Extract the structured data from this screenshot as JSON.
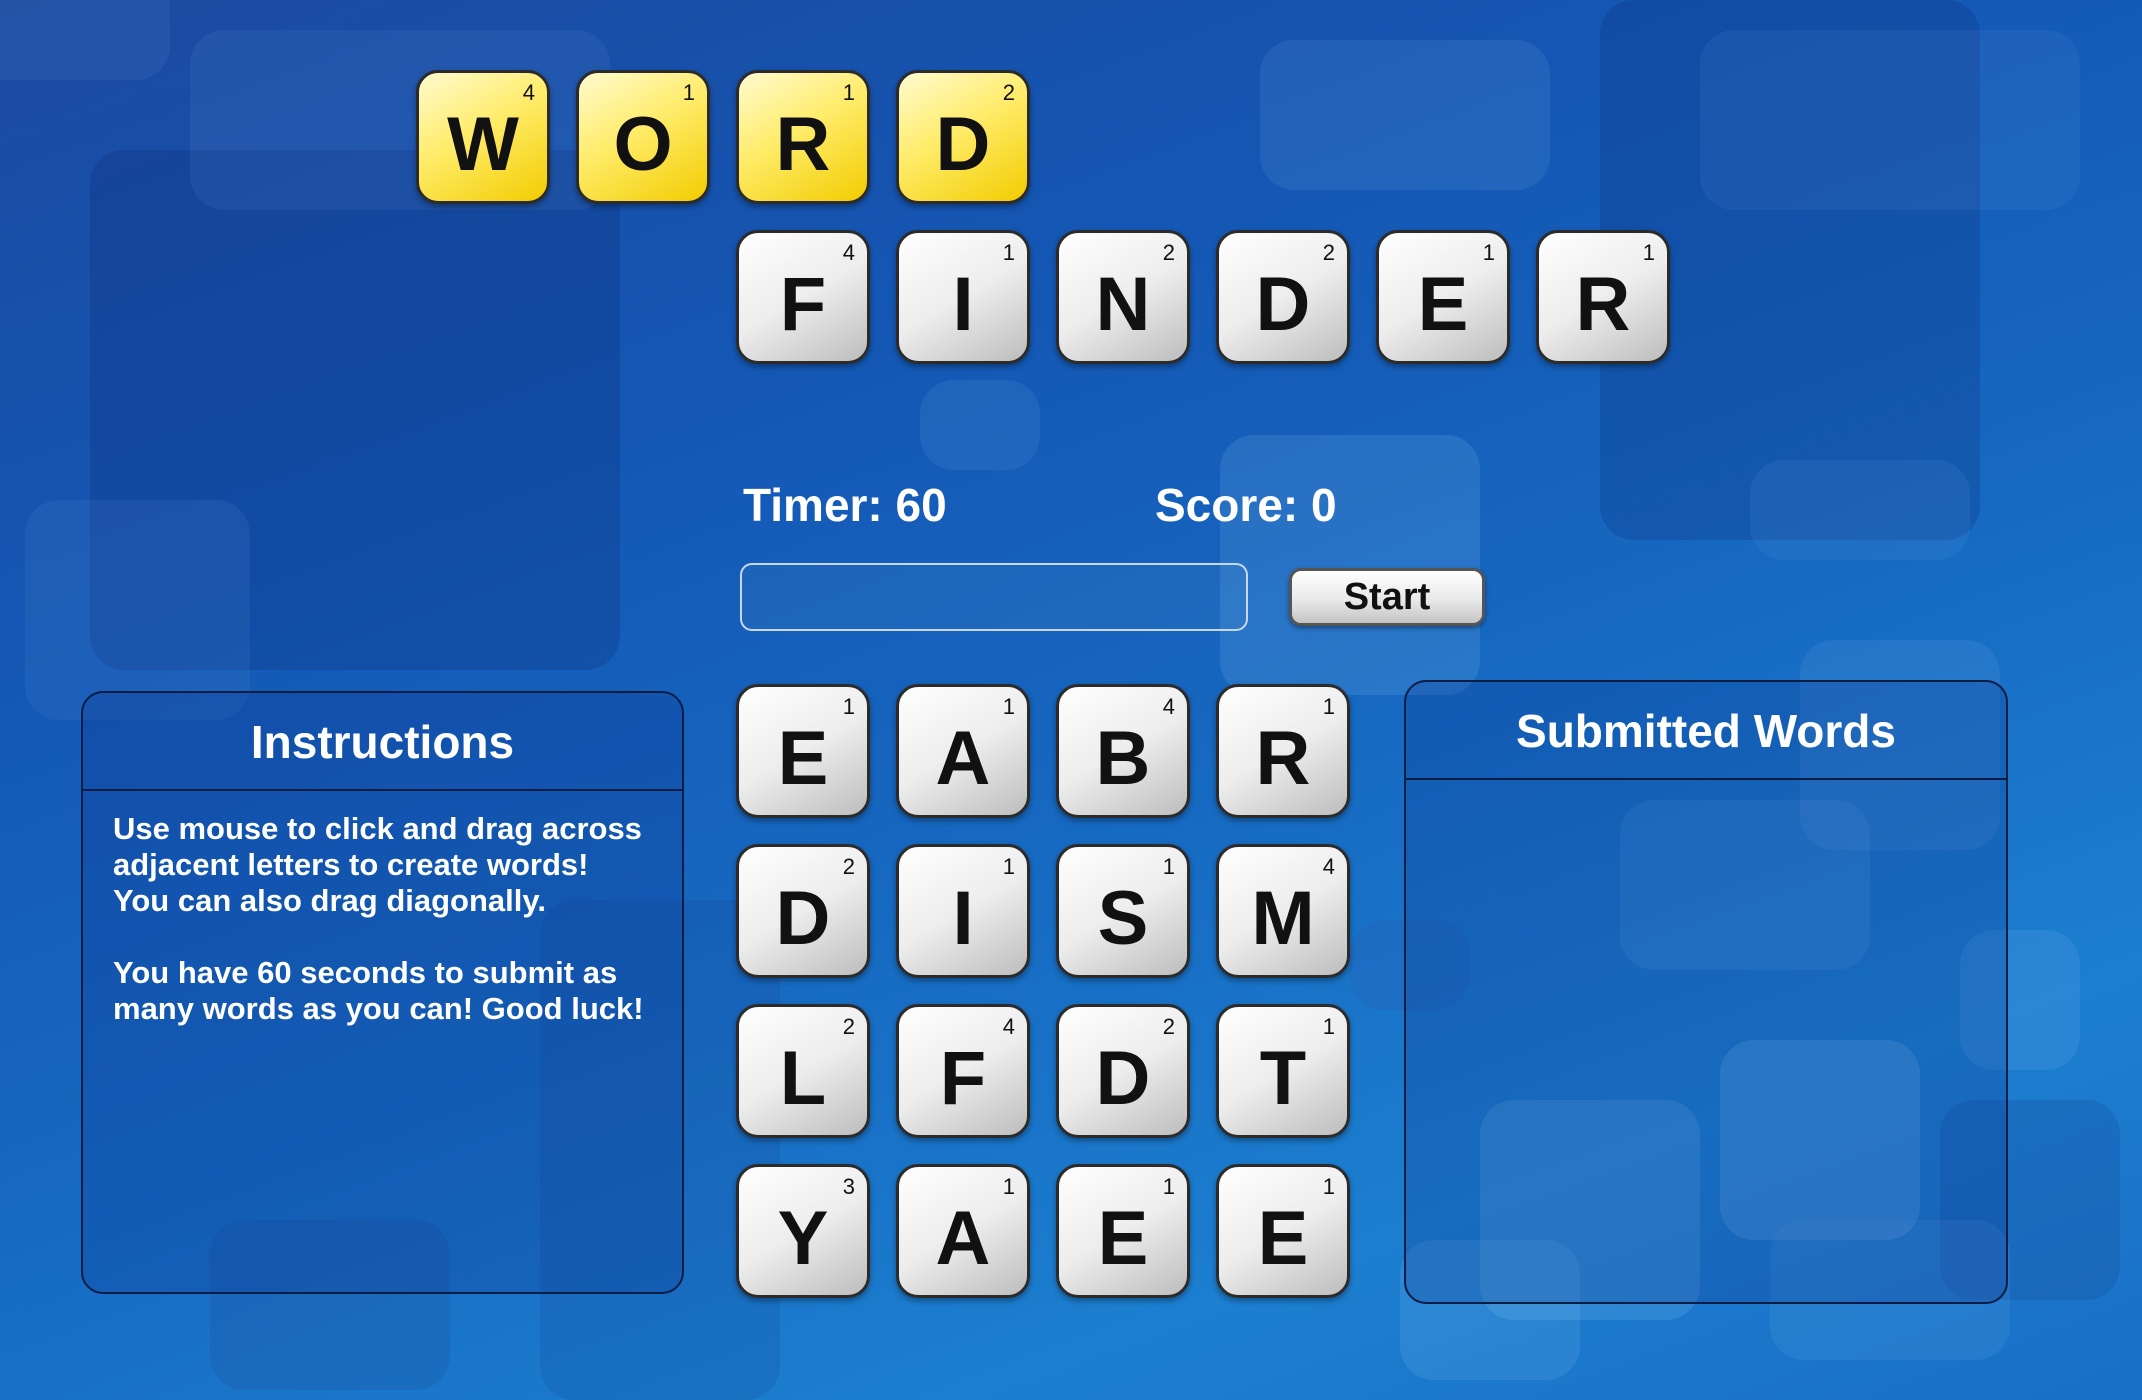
{
  "title": {
    "row1": [
      {
        "letter": "W",
        "points": "4"
      },
      {
        "letter": "O",
        "points": "1"
      },
      {
        "letter": "R",
        "points": "1"
      },
      {
        "letter": "D",
        "points": "2"
      }
    ],
    "row2": [
      {
        "letter": "F",
        "points": "4"
      },
      {
        "letter": "I",
        "points": "1"
      },
      {
        "letter": "N",
        "points": "2"
      },
      {
        "letter": "D",
        "points": "2"
      },
      {
        "letter": "E",
        "points": "1"
      },
      {
        "letter": "R",
        "points": "1"
      }
    ]
  },
  "status": {
    "timer_label": "Timer: 60",
    "score_label": "Score: 0"
  },
  "controls": {
    "word_input_value": "",
    "word_input_placeholder": "",
    "start_label": "Start"
  },
  "board": [
    [
      {
        "letter": "E",
        "points": "1"
      },
      {
        "letter": "A",
        "points": "1"
      },
      {
        "letter": "B",
        "points": "4"
      },
      {
        "letter": "R",
        "points": "1"
      }
    ],
    [
      {
        "letter": "D",
        "points": "2"
      },
      {
        "letter": "I",
        "points": "1"
      },
      {
        "letter": "S",
        "points": "1"
      },
      {
        "letter": "M",
        "points": "4"
      }
    ],
    [
      {
        "letter": "L",
        "points": "2"
      },
      {
        "letter": "F",
        "points": "4"
      },
      {
        "letter": "D",
        "points": "2"
      },
      {
        "letter": "T",
        "points": "1"
      }
    ],
    [
      {
        "letter": "Y",
        "points": "3"
      },
      {
        "letter": "A",
        "points": "1"
      },
      {
        "letter": "E",
        "points": "1"
      },
      {
        "letter": "E",
        "points": "1"
      }
    ]
  ],
  "instructions": {
    "title": "Instructions",
    "paragraph1": "Use mouse to click and drag across adjacent letters to create words! You can also drag diagonally.",
    "paragraph2": "You have 60 seconds to submit as many words as you can! Good luck!"
  },
  "submitted": {
    "title": "Submitted Words",
    "words": []
  },
  "colors": {
    "background": "#1457b4",
    "title_tile_yellow": "#ffe84a",
    "tile_white": "#ededed"
  }
}
